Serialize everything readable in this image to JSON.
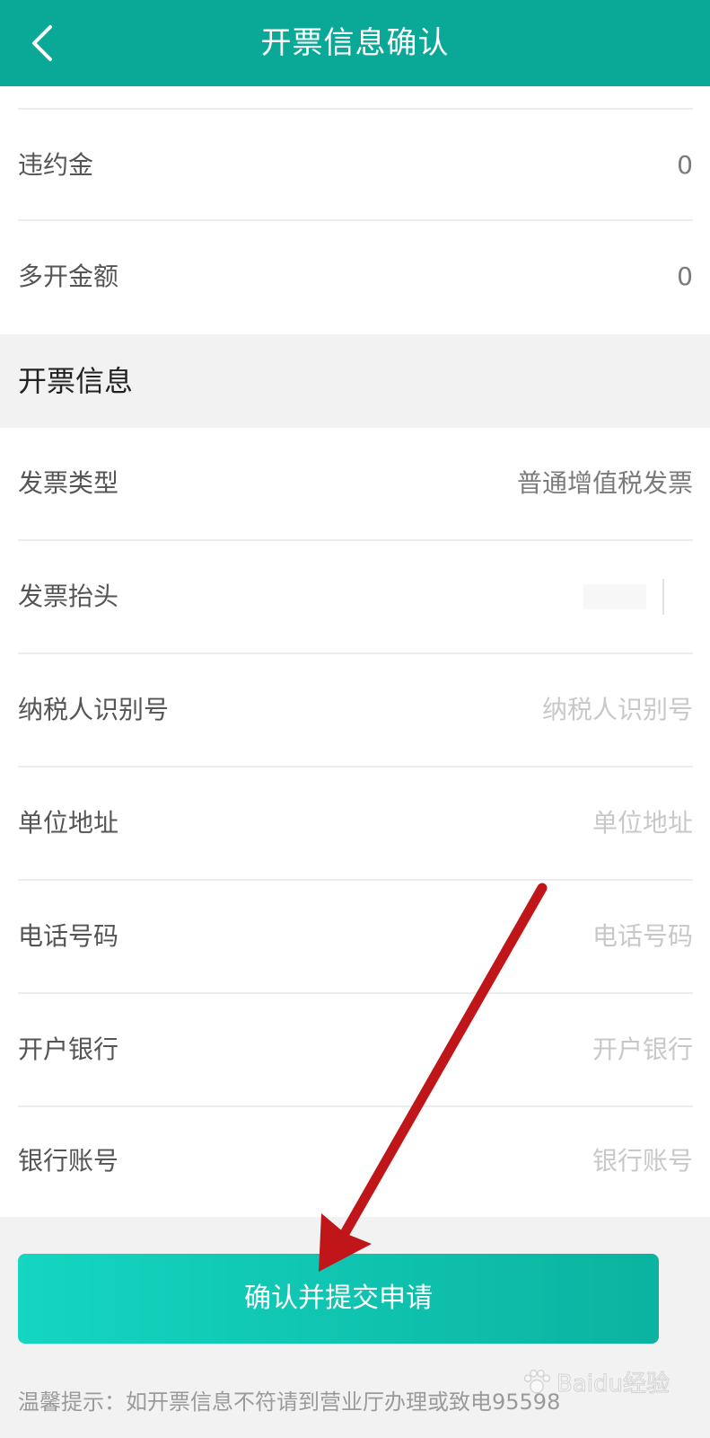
{
  "header": {
    "title": "开票信息确认"
  },
  "top_rows": [
    {
      "label": "违约金",
      "value": "0"
    },
    {
      "label": "多开金额",
      "value": "0"
    }
  ],
  "invoice_section": {
    "title": "开票信息",
    "invoice_type": {
      "label": "发票类型",
      "value": "普通增值税发票"
    },
    "invoice_title": {
      "label": "发票抬头",
      "value": ""
    },
    "fields": [
      {
        "label": "纳税人识别号",
        "placeholder": "纳税人识别号"
      },
      {
        "label": "单位地址",
        "placeholder": "单位地址"
      },
      {
        "label": "电话号码",
        "placeholder": "电话号码"
      },
      {
        "label": "开户银行",
        "placeholder": "开户银行"
      },
      {
        "label": "银行账号",
        "placeholder": "银行账号"
      }
    ]
  },
  "submit_label": "确认并提交申请",
  "tip": "温馨提示：如开票信息不符请到营业厅办理或致电95598",
  "watermark": "Baidu经验",
  "icons": {
    "back": "chevron-left-icon",
    "annotation": "red-arrow-icon"
  },
  "colors": {
    "header": "#0aa897",
    "button_start": "#14d6c1",
    "button_end": "#0bb3a0",
    "annotation_arrow": "#c0161a"
  }
}
